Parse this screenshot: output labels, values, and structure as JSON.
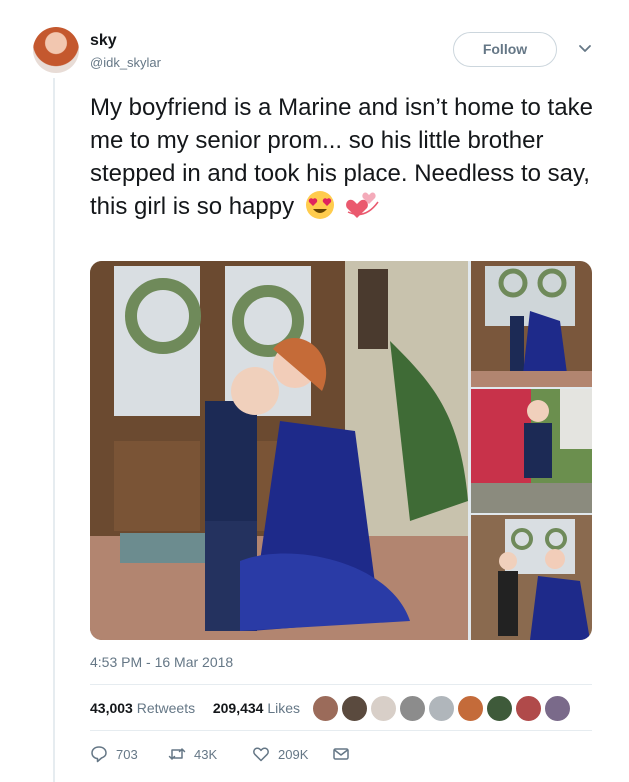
{
  "user": {
    "name": "sky",
    "handle": "@idk_skylar"
  },
  "follow_label": "Follow",
  "tweet": {
    "text": "My boyfriend is a Marine and isn’t home to take me to my senior prom... so his little brother stepped in and took his place. Needless to say, this girl is so happy",
    "emojis": [
      "heart-eyes-emoji",
      "revolving-hearts-emoji"
    ]
  },
  "timestamp": "4:53 PM - 16 Mar 2018",
  "stats": {
    "retweets_count": "43,003",
    "retweets_label": "Retweets",
    "likes_count": "209,434",
    "likes_label": "Likes"
  },
  "actions": {
    "reply_count": "703",
    "retweet_count": "43K",
    "like_count": "209K"
  },
  "colors": {
    "text": "#14171a",
    "secondary": "#657786",
    "border": "#e6ecf0"
  }
}
